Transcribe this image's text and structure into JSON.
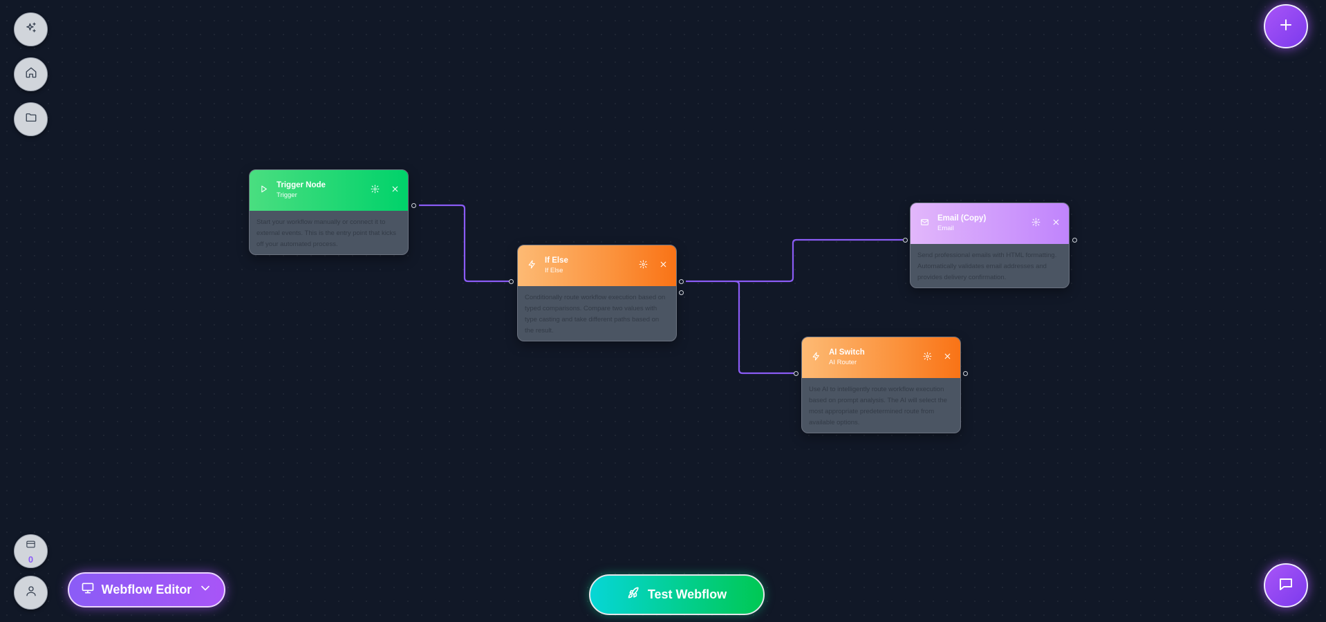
{
  "rail": {
    "magic_icon": "sparkles-icon",
    "home_icon": "home-icon",
    "folder_icon": "folder-icon",
    "credits_icon": "credit-card-icon",
    "credits_count": "0",
    "user_icon": "user-icon"
  },
  "fab": {
    "add_icon": "plus-icon",
    "chat_icon": "message-icon"
  },
  "bottom": {
    "editor_label": "Webflow Editor",
    "test_label": "Test Webflow"
  },
  "nodes": [
    {
      "title": "Trigger Node",
      "subtitle": "Trigger",
      "description": "Start your workflow manually or connect it to external events. This is the entry point that kicks off your automated process.",
      "color": "#00d26a",
      "icon": "play-icon"
    },
    {
      "title": "If Else",
      "subtitle": "If Else",
      "description": "Conditionally route workflow execution based on typed comparisons. Compare two values with type casting and take different paths based on the result.",
      "color": "#f97316",
      "icon": "zap-icon"
    },
    {
      "title": "Email (Copy)",
      "subtitle": "Email",
      "description": "Send professional emails with HTML formatting. Automatically validates email addresses and provides delivery confirmation.",
      "color": "#c084fc",
      "icon": "mail-icon"
    },
    {
      "title": "AI Switch",
      "subtitle": "AI Router",
      "description": "Use AI to intelligently route workflow execution based on prompt analysis. The AI will select the most appropriate predetermined route from available options.",
      "color": "#f97316",
      "icon": "zap-icon"
    }
  ],
  "colors": {
    "background": "#111827",
    "edge": "#8b5cf6",
    "accent": "#a855f7"
  }
}
